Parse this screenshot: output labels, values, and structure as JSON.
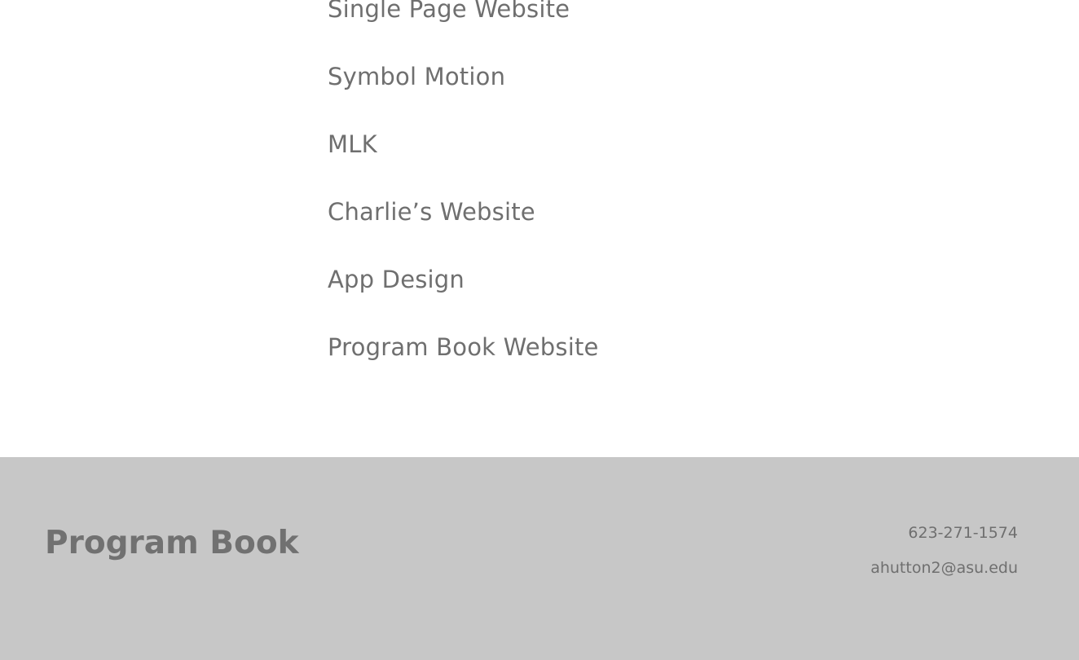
{
  "projects": {
    "items": [
      {
        "label": "Single Page Website"
      },
      {
        "label": "Symbol Motion"
      },
      {
        "label": "MLK"
      },
      {
        "label": "Charlie’s Website"
      },
      {
        "label": "App Design"
      },
      {
        "label": "Program Book Website"
      }
    ]
  },
  "footer": {
    "brand": "Program Book",
    "phone": "623-271-1574",
    "email": "ahutton2@asu.edu",
    "background_color": "#c7c7c7",
    "text_color": "#6f6f6f"
  }
}
